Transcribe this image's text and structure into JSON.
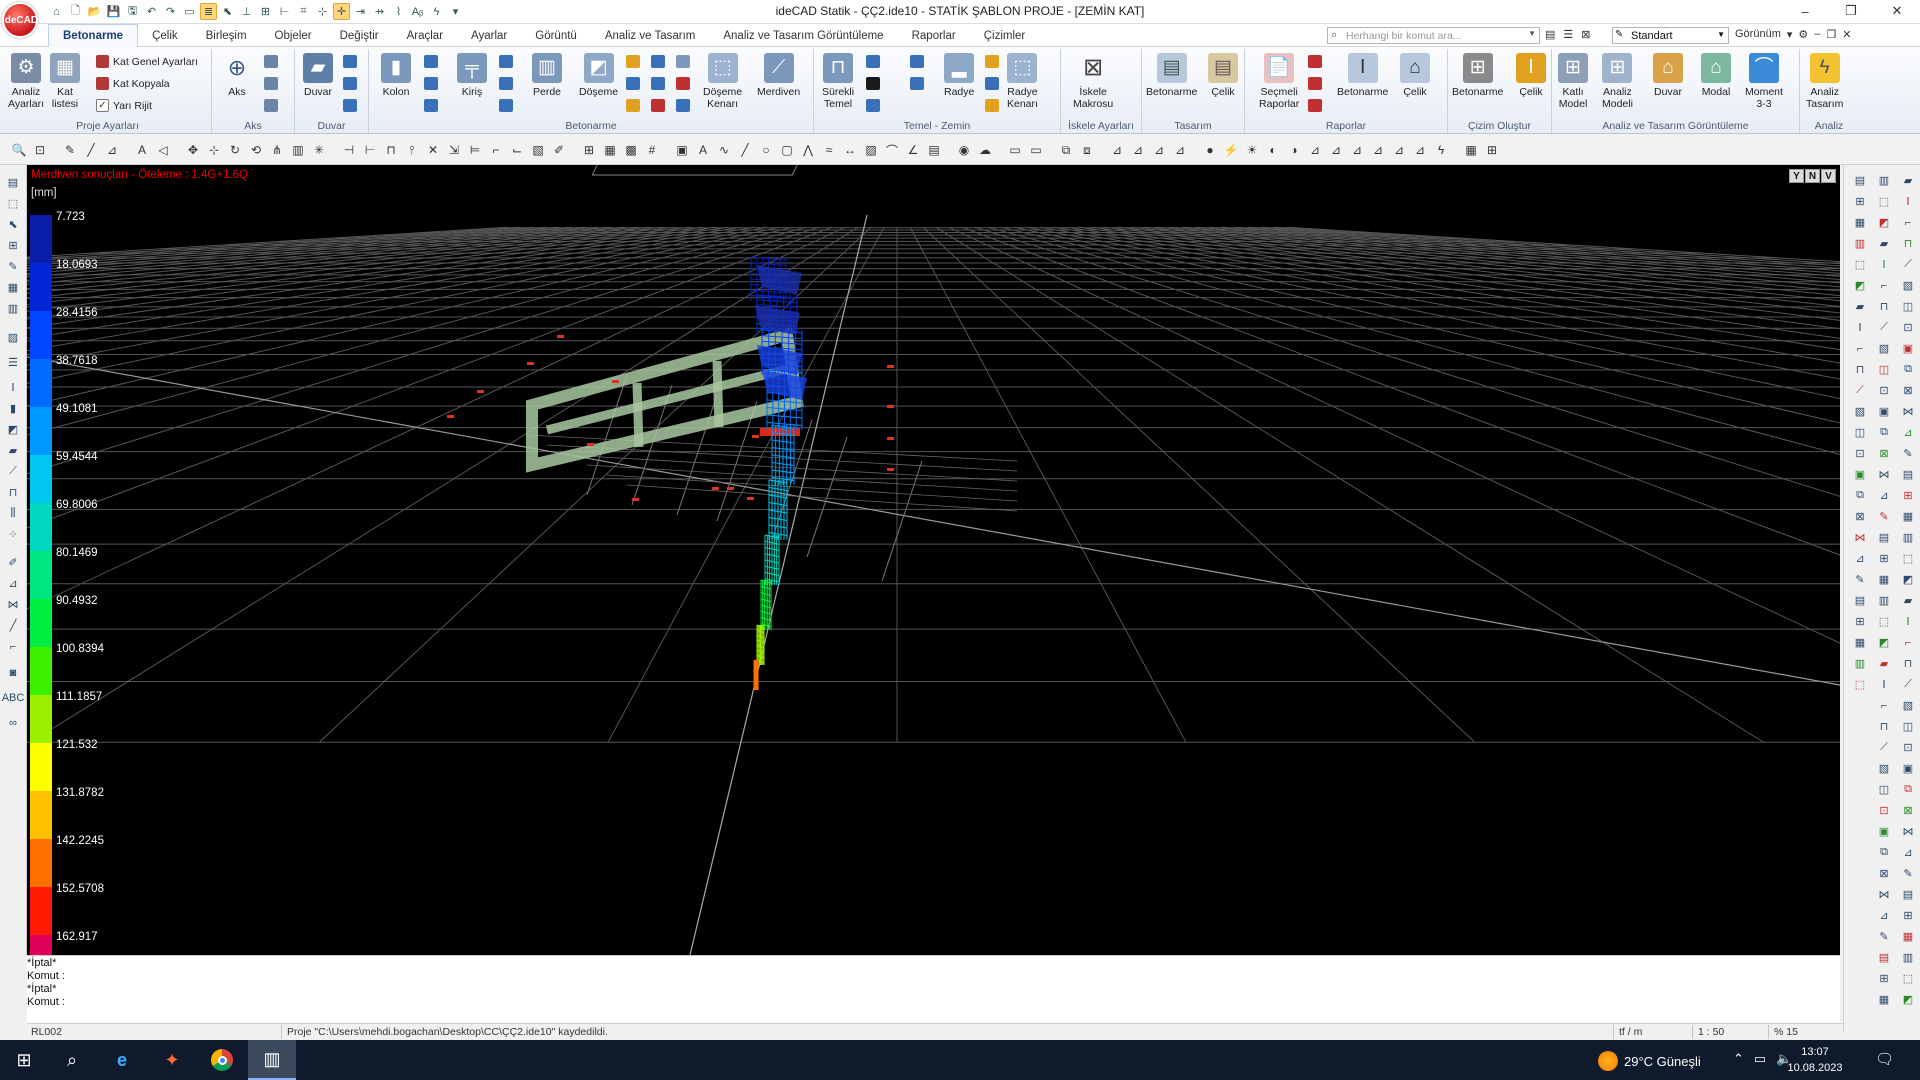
{
  "app": {
    "logo": "ideCAD",
    "window_title": "ideCAD Statik - ÇÇ2.ide10 - STATİK ŞABLON PROJE - [ZEMİN KAT]",
    "controls": [
      "–",
      "❐",
      "✕"
    ]
  },
  "menu": {
    "tabs": [
      "Betonarme",
      "Çelik",
      "Birleşim",
      "Objeler",
      "Değiştir",
      "Araçlar",
      "Ayarlar",
      "Görüntü",
      "Analiz ve Tasarım",
      "Analiz ve Tasarım Görüntüleme",
      "Raporlar",
      "Çizimler"
    ],
    "active_tab": "Betonarme",
    "search_placeholder": "Herhangi bir komut ara...",
    "style_value": "Standart",
    "view_label": "Görünüm"
  },
  "ribbon": {
    "proje_ayarlari": {
      "label": "Proje Ayarları",
      "analiz_ayarlari": "Analiz\nAyarları",
      "kat_listesi": "Kat\nlistesi",
      "kat_genel_ayarlari": "Kat Genel Ayarları",
      "kat_kopyala": "Kat Kopyala",
      "yari_rijit": "Yarı Rijit"
    },
    "aks": {
      "label": "Aks",
      "aks": "Aks"
    },
    "duvar": {
      "label": "Duvar",
      "duvar": "Duvar"
    },
    "betonarme": {
      "label": "Betonarme",
      "kolon": "Kolon",
      "kiris": "Kiriş",
      "perde": "Perde",
      "doseme": "Döşeme",
      "doseme_kenari": "Döşeme\nKenarı",
      "merdiven": "Merdiven"
    },
    "temel": {
      "label": "Temel - Zemin",
      "surekli_temel": "Sürekli\nTemel",
      "radye": "Radye",
      "radye_kenari": "Radye\nKenarı"
    },
    "iskele": {
      "label": "İskele Ayarları",
      "iskele_makrosu": "İskele\nMakrosu"
    },
    "tasarim": {
      "label": "Tasarım",
      "betonarme": "Betonarme",
      "celik": "Çelik"
    },
    "raporlar": {
      "label": "Raporlar",
      "secmeli_raporlar": "Seçmeli\nRaporlar",
      "betonarme": "Betonarme",
      "celik": "Çelik"
    },
    "cizim": {
      "label": "Çizim Oluştur",
      "betonarme": "Betonarme",
      "celik": "Çelik"
    },
    "goruntuleme": {
      "label": "Analiz ve Tasarım Görüntüleme",
      "katli_model": "Katlı\nModel",
      "analiz_modeli": "Analiz\nModeli",
      "duvar": "Duvar",
      "modal": "Modal",
      "moment": "Moment\n3-3"
    },
    "analiz": {
      "label": "Analiz",
      "analiz_tasarim": "Analiz\nTasarım"
    }
  },
  "viewport": {
    "title": "Merdiven sonuçları - Öteleme : 1.4G+1.6Q",
    "unit": "[mm]",
    "legend_values": [
      "7.723",
      "18.0693",
      "28.4156",
      "38.7618",
      "49.1081",
      "59.4544",
      "69.8006",
      "80.1469",
      "90.4932",
      "100.8394",
      "111.1857",
      "121.532",
      "131.8782",
      "142.2245",
      "152.5708",
      "162.917"
    ],
    "legend_colors": [
      "#0a1fa8",
      "#0026d6",
      "#0048ff",
      "#006cff",
      "#0098ff",
      "#00c6f0",
      "#00d8c0",
      "#00e680",
      "#00ee40",
      "#3cf000",
      "#9af000",
      "#ffff00",
      "#ffc000",
      "#ff7000",
      "#ff1a00",
      "#e0005a"
    ],
    "view_buttons": [
      "Y",
      "N",
      "V"
    ]
  },
  "command_area": {
    "lines": [
      "*İptal*",
      "Komut :",
      "*İptal*",
      "Komut :"
    ]
  },
  "status": {
    "left": "RL002",
    "message": "Proje \"C:\\Users\\mehdi.bogachan\\Desktop\\CC\\ÇÇ2.ide10\" kaydedildi.",
    "unit": "tf / m",
    "scale": "1 : 50",
    "percent": "% 15"
  },
  "taskbar": {
    "weather": "29°C  Güneşli",
    "time": "13:07",
    "date": "10.08.2023"
  }
}
